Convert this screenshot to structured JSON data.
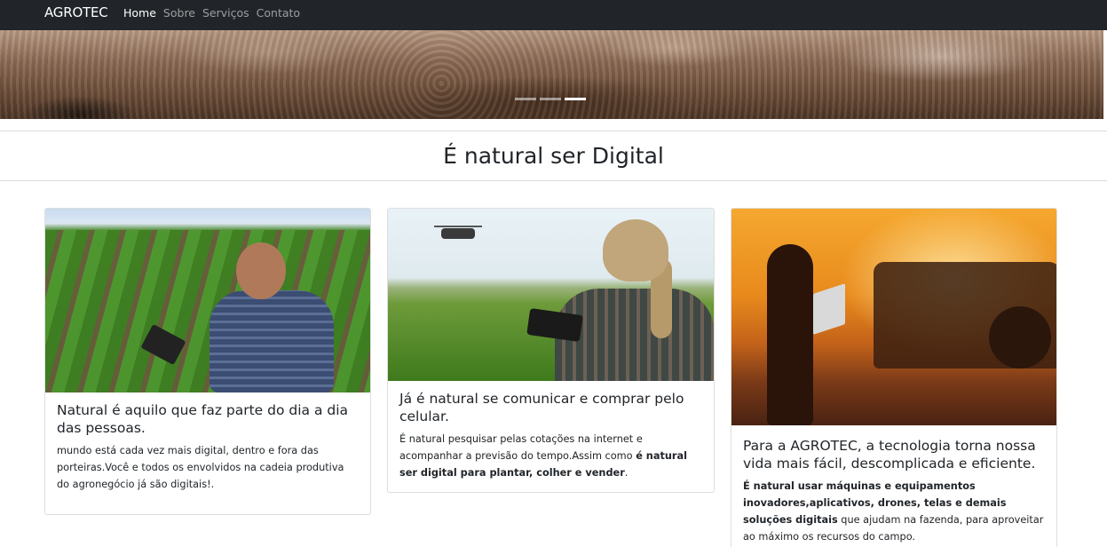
{
  "navbar": {
    "brand": "AGROTEC",
    "links": [
      {
        "label": "Home",
        "active": true
      },
      {
        "label": "Sobre",
        "active": false
      },
      {
        "label": "Serviços",
        "active": false
      },
      {
        "label": "Contato",
        "active": false
      }
    ]
  },
  "carousel": {
    "slides_count": 3,
    "active_index": 2
  },
  "section": {
    "title": "É natural ser Digital"
  },
  "cards": [
    {
      "title": "Natural é aquilo que faz parte do dia a dia das pessoas.",
      "text": "mundo está cada vez mais digital, dentro e fora das porteiras.Você e todos os envolvidos na cadeia produtiva do agronegócio já são digitais!."
    },
    {
      "title": "Já é natural se comunicar e comprar pelo celular.",
      "text_before": "É natural pesquisar pelas cotações na internet e acompanhar a previsão do tempo.Assim como ",
      "text_bold": "é natural ser digital para plantar, colher e vender",
      "text_after": "."
    },
    {
      "title": "Para a AGROTEC, a tecnologia torna nossa vida mais fácil, descomplicada e eficiente.",
      "text_bold": "É natural usar máquinas e equipamentos inovadores,aplicativos, drones, telas e demais soluções digitais",
      "text_after": " que ajudam na fazenda, para aproveitar ao máximo os recursos do campo."
    }
  ],
  "colors": {
    "navbar_bg": "#212529",
    "nav_active": "#ffffff",
    "nav_inactive": "rgba(255,255,255,0.55)"
  }
}
